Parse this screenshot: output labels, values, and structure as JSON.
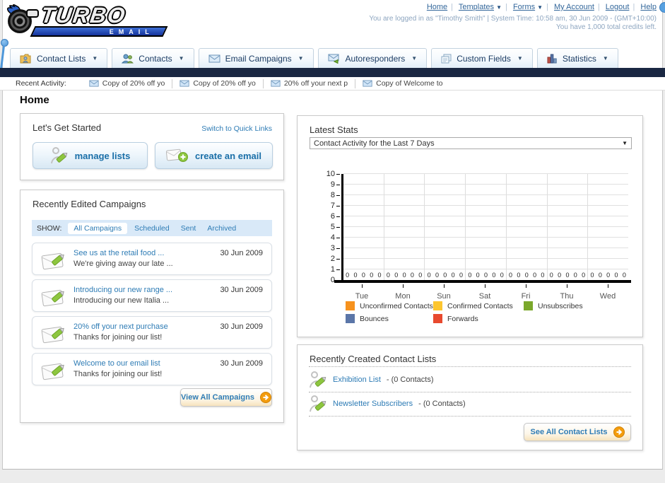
{
  "colors": {
    "link_blue": "#2E7CB5",
    "nav_blue": "#33679B",
    "dark_bar": "#1A2742",
    "accent_orange": "#F49C0C"
  },
  "header": {
    "logo_line1": "TURBO",
    "logo_line2": "EMAIL",
    "nav_links": [
      "Home",
      "Templates",
      "Forms",
      "My Account",
      "Logout",
      "Help"
    ],
    "login_line1": "You are logged in as \"Timothy Smith\" | System Time: 10:58 am, 30 Jun 2009 - (GMT+10:00)",
    "login_line2": "You have 1,000 total credits left."
  },
  "tabs": [
    {
      "label": "Contact Lists",
      "icon": "folder-user-icon"
    },
    {
      "label": "Contacts",
      "icon": "users-icon"
    },
    {
      "label": "Email Campaigns",
      "icon": "envelope-icon"
    },
    {
      "label": "Autoresponders",
      "icon": "envelope-arrow-icon"
    },
    {
      "label": "Custom Fields",
      "icon": "pages-icon"
    },
    {
      "label": "Statistics",
      "icon": "bar-chart-icon"
    }
  ],
  "recent_activity": {
    "label": "Recent Activity:",
    "items": [
      "Copy of 20% off yo",
      "Copy of 20% off yo",
      "20% off your next p",
      "Copy of Welcome to"
    ]
  },
  "page_title": "Home",
  "get_started": {
    "title": "Let's Get Started",
    "switch_link": "Switch to Quick Links",
    "manage_lists_label": "manage lists",
    "create_email_label": "create an email"
  },
  "campaigns": {
    "title": "Recently Edited Campaigns",
    "show_label": "SHOW:",
    "filters": [
      "All Campaigns",
      "Scheduled",
      "Sent",
      "Archived"
    ],
    "active_filter": "All Campaigns",
    "items": [
      {
        "title": "See us at the retail food ...",
        "subtitle": "We're giving away our late ...",
        "date": "30 Jun 2009"
      },
      {
        "title": "Introducing our new range ...",
        "subtitle": "Introducing our new Italia ...",
        "date": "30 Jun 2009"
      },
      {
        "title": "20% off your next purchase",
        "subtitle": "Thanks for joining our list!",
        "date": "30 Jun 2009"
      },
      {
        "title": "Welcome to our email list",
        "subtitle": "Thanks for joining our list!",
        "date": "30 Jun 2009"
      }
    ],
    "view_all_label": "View All Campaigns"
  },
  "stats": {
    "title": "Latest Stats",
    "dropdown_value": "Contact Activity for the Last 7 Days",
    "chart_data": {
      "type": "bar",
      "title": "Contact Activity for the Last 7 Days",
      "categories": [
        "Tue",
        "Mon",
        "Sun",
        "Sat",
        "Fri",
        "Thu",
        "Wed"
      ],
      "series": [
        {
          "name": "Unconfirmed Contacts",
          "color": "#F6921E",
          "values": [
            0,
            0,
            0,
            0,
            0,
            0,
            0
          ]
        },
        {
          "name": "Confirmed Contacts",
          "color": "#FDC62F",
          "values": [
            0,
            0,
            0,
            0,
            0,
            0,
            0
          ]
        },
        {
          "name": "Unsubscribes",
          "color": "#7BA82C",
          "values": [
            0,
            0,
            0,
            0,
            0,
            0,
            0
          ]
        },
        {
          "name": "Bounces",
          "color": "#5B76A8",
          "values": [
            0,
            0,
            0,
            0,
            0,
            0,
            0
          ]
        },
        {
          "name": "Forwards",
          "color": "#E8492E",
          "values": [
            0,
            0,
            0,
            0,
            0,
            0,
            0
          ]
        }
      ],
      "ylim": [
        0,
        10
      ],
      "yticks": [
        0,
        1,
        2,
        3,
        4,
        5,
        6,
        7,
        8,
        9,
        10
      ],
      "grid": true,
      "legend_position": "bottom"
    }
  },
  "contact_lists": {
    "title": "Recently Created Contact Lists",
    "items": [
      {
        "name": "Exhibition List",
        "detail": "- (0 Contacts)"
      },
      {
        "name": "Newsletter Subscribers",
        "detail": "- (0 Contacts)"
      }
    ],
    "see_all_label": "See All Contact Lists"
  }
}
